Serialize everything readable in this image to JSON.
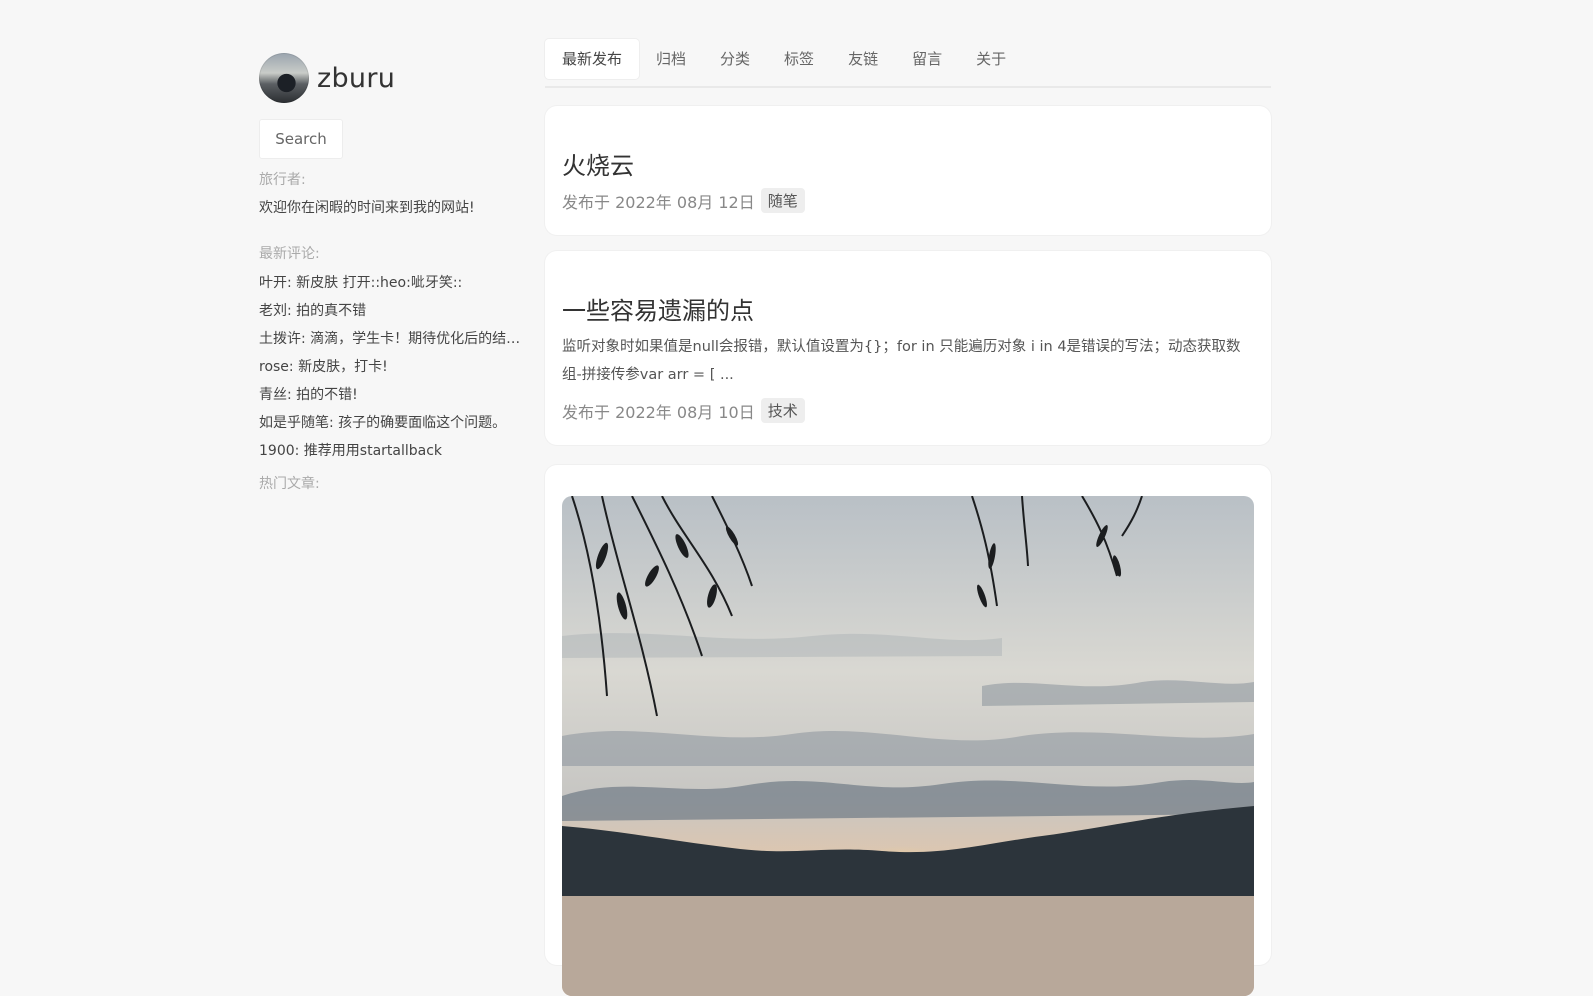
{
  "site": {
    "name": "zburu",
    "search_label": "Search"
  },
  "sidebar": {
    "traveler_label": "旅行者:",
    "welcome": "欢迎你在闲暇的时间来到我的网站!",
    "recent_comments_label": "最新评论:",
    "comments": [
      "叶开: 新皮肤 打开::heo:呲牙笑::",
      "老刘: 拍的真不错",
      "土拨许: 滴滴，学生卡！期待优化后的结…",
      "rose: 新皮肤，打卡!",
      "青丝: 拍的不错!",
      "如是乎随笔: 孩子的确要面临这个问题。",
      "1900: 推荐用用startallback"
    ],
    "hot_posts_label": "热门文章:"
  },
  "nav": {
    "items": [
      "最新发布",
      "归档",
      "分类",
      "标签",
      "友链",
      "留言",
      "关于"
    ],
    "active": "最新发布"
  },
  "posts": [
    {
      "title": "火烧云",
      "date": "发布于 2022年 08月 12日",
      "tag": "随笔"
    },
    {
      "title": "一些容易遗漏的点",
      "excerpt": "监听对象时如果值是null会报错，默认值设置为{}；for in 只能遍历对象 i in 4是错误的写法；动态获取数组-拼接传参var arr = [ ...",
      "date": "发布于 2022年 08月 10日",
      "tag": "技术"
    }
  ],
  "colors": {
    "background": "#f7f7f7",
    "card": "#ffffff",
    "text": "#333333",
    "muted": "#aaaaaa",
    "tag_bg": "#eeeeee"
  }
}
